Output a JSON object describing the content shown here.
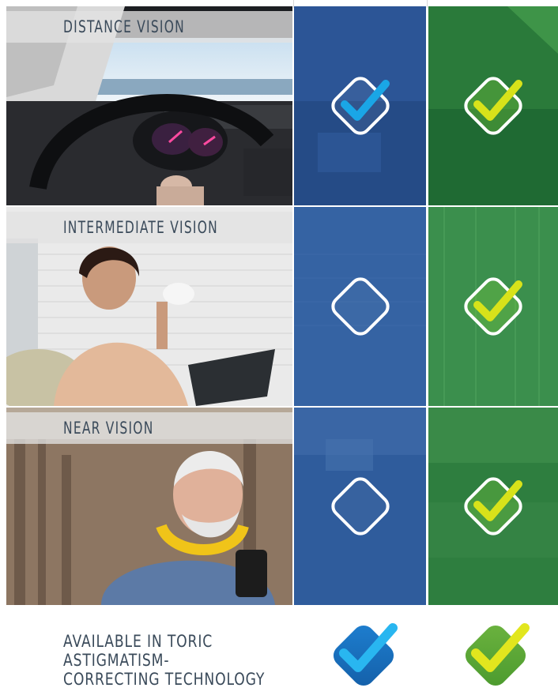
{
  "rows": [
    {
      "label": "DISTANCE  VISION",
      "col_a_checked": true,
      "col_b_checked": true
    },
    {
      "label": "INTERMEDIATE  VISION",
      "col_a_checked": false,
      "col_b_checked": true
    },
    {
      "label": "NEAR  VISION",
      "col_a_checked": false,
      "col_b_checked": true
    }
  ],
  "footer": {
    "line1": "AVAILABLE IN TORIC ASTIGMATISM-",
    "line2": "CORRECTING TECHNOLOGY"
  },
  "colors": {
    "col_a_tint": "#2f5f9e",
    "col_b_tint": "#2e8a3e",
    "check_blue": "#1aa6e6",
    "check_lime": "#d8e21a",
    "label_text": "#3a4a5a"
  },
  "icons": {
    "checked": "diamond-check-icon",
    "unchecked": "diamond-outline-icon",
    "photo_1": "car-dashboard-photo",
    "photo_2": "woman-with-tablet-photo",
    "photo_3": "man-with-phone-photo"
  }
}
